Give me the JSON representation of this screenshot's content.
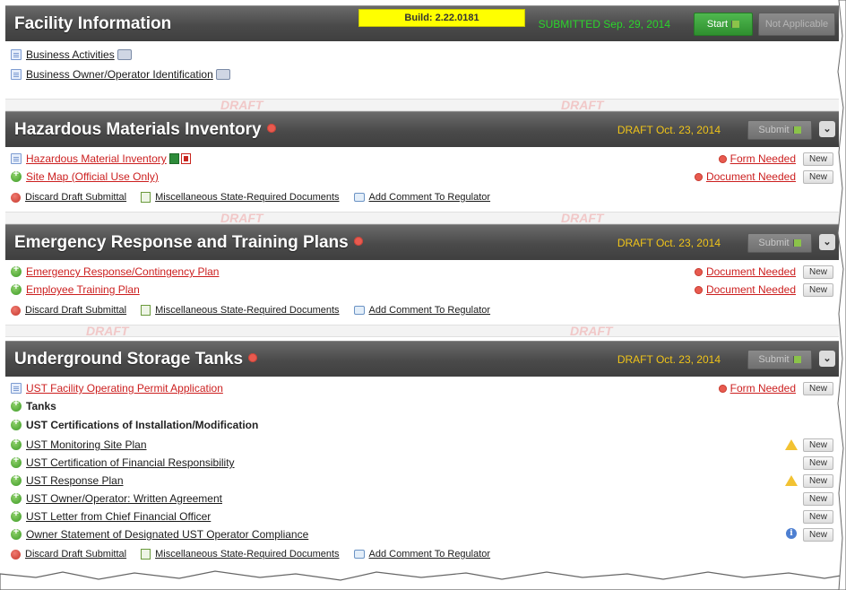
{
  "build_banner": "Build: 2.22.0181",
  "facility": {
    "title": "Facility Information",
    "status": "SUBMITTED Sep. 29, 2014",
    "start_label": "Start",
    "na_label": "Not Applicable",
    "links": [
      {
        "label": "Business Activities",
        "icon": "print-icon"
      },
      {
        "label": "Business Owner/Operator Identification",
        "icon": "print-icon"
      }
    ]
  },
  "actions": {
    "discard": "Discard Draft Submittal",
    "misc": "Miscellaneous State-Required Documents",
    "comment": "Add Comment To Regulator"
  },
  "new_label": "New",
  "hazmat": {
    "title": "Hazardous Materials Inventory",
    "draft": "DRAFT Oct. 23, 2014",
    "submit_label": "Submit",
    "collapse_glyph": "⌄",
    "rows": [
      {
        "label": "Hazardous Material Inventory",
        "status": "Form Needed"
      },
      {
        "label": "Site Map (Official Use Only)",
        "status": "Document Needed"
      }
    ]
  },
  "emergency": {
    "title": "Emergency Response and Training Plans",
    "draft": "DRAFT Oct. 23, 2014",
    "submit_label": "Submit",
    "rows": [
      {
        "label": "Emergency Response/Contingency Plan",
        "status": "Document Needed"
      },
      {
        "label": "Employee Training Plan",
        "status": "Document Needed"
      }
    ]
  },
  "ust": {
    "title": "Underground Storage Tanks",
    "draft": "DRAFT Oct. 23, 2014",
    "submit_label": "Submit",
    "permit": {
      "label": "UST Facility Operating Permit Application",
      "status": "Form Needed"
    },
    "tanks_label": "Tanks",
    "certs_label": "UST Certifications of Installation/Modification",
    "rows": [
      {
        "label": "UST Monitoring Site Plan",
        "flag": "warning"
      },
      {
        "label": "UST Certification of Financial Responsibility",
        "flag": ""
      },
      {
        "label": "UST Response Plan",
        "flag": "warning"
      },
      {
        "label": "UST Owner/Operator: Written Agreement",
        "flag": ""
      },
      {
        "label": "UST Letter from Chief Financial Officer",
        "flag": ""
      },
      {
        "label": "Owner Statement of Designated UST Operator Compliance",
        "flag": "info"
      }
    ]
  },
  "watermark_text": "DRAFT",
  "colors": {
    "header_bg": "#4a4a4a",
    "draft": "#f0c419",
    "submitted": "#2bd52b",
    "required_link": "#cc1f1f",
    "start_button": "#3a9f3a",
    "build_banner": "#ffff00"
  }
}
